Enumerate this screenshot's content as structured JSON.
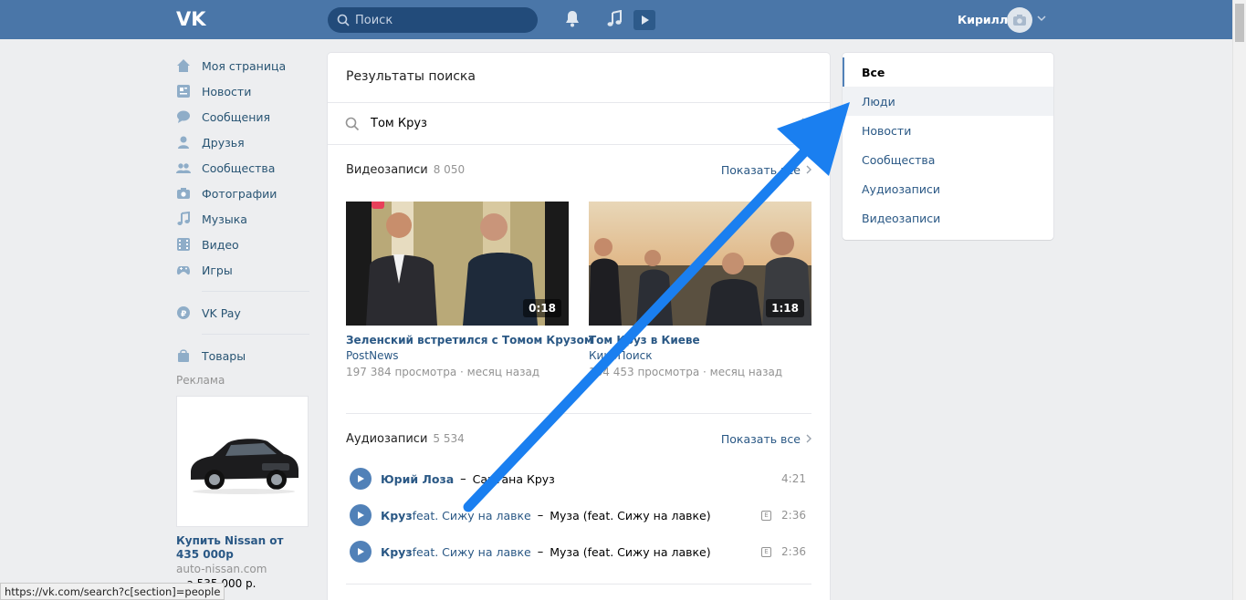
{
  "header": {
    "search_placeholder": "Поиск",
    "user_name": "Кирилл",
    "brand_color": "#4a76a8"
  },
  "left_nav": {
    "items": [
      {
        "label": "Моя страница",
        "icon": "home-icon"
      },
      {
        "label": "Новости",
        "icon": "news-icon"
      },
      {
        "label": "Сообщения",
        "icon": "messages-icon"
      },
      {
        "label": "Друзья",
        "icon": "friends-icon"
      },
      {
        "label": "Сообщества",
        "icon": "communities-icon"
      },
      {
        "label": "Фотографии",
        "icon": "photos-icon"
      },
      {
        "label": "Музыка",
        "icon": "music-icon"
      },
      {
        "label": "Видео",
        "icon": "video-icon"
      },
      {
        "label": "Игры",
        "icon": "games-icon"
      }
    ],
    "vkpay": "VK Pay",
    "goods": "Товары",
    "ads_label": "Реклама",
    "ad": {
      "title": "Купить Nissan от 435 000р",
      "domain": "auto-nissan.com",
      "price": "...а 535 000 р."
    }
  },
  "main": {
    "title": "Результаты поиска",
    "query": "Том Круз",
    "videos_section": {
      "title": "Видеозаписи",
      "count": "8 050",
      "show_all": "Показать все"
    },
    "videos": [
      {
        "title": "Зеленский встретился с Томом Крузом",
        "author": "PostNews",
        "meta": "197 384 просмотра · месяц назад",
        "duration": "0:18"
      },
      {
        "title": "Том Круз в Киеве",
        "author": "КиноПоиск",
        "meta": "104 453 просмотра · месяц назад",
        "duration": "1:18"
      }
    ],
    "audio_section": {
      "title": "Аудиозаписи",
      "count": "5 534",
      "show_all": "Показать все"
    },
    "tracks": [
      {
        "artist": "Юрий Лоза",
        "feat": "",
        "title": "Сантана Круз",
        "explicit": false,
        "duration": "4:21"
      },
      {
        "artist": "Круз",
        "feat": " feat. Сижу на лавке",
        "title": "Муза (feat. Сижу на лавке)",
        "explicit": true,
        "duration": "2:36"
      },
      {
        "artist": "Круз",
        "feat": " feat. Сижу на лавке",
        "title": "Муза (feat. Сижу на лавке)",
        "explicit": true,
        "duration": "2:36"
      }
    ]
  },
  "filters": {
    "items": [
      "Все",
      "Люди",
      "Новости",
      "Сообщества",
      "Аудиозаписи",
      "Видеозаписи"
    ],
    "active": "Все",
    "hovered": "Люди"
  },
  "status_bar": {
    "url": "https://vk.com/search?c[section]=people"
  },
  "annotation": {
    "arrow_color": "#1a7ff0"
  }
}
